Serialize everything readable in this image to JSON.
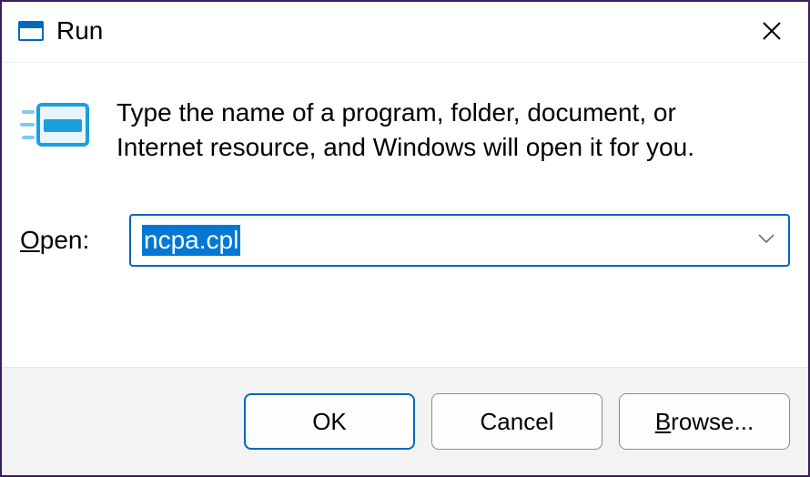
{
  "titlebar": {
    "title": "Run"
  },
  "description": "Type the name of a program, folder, document, or Internet resource, and Windows will open it for you.",
  "open": {
    "label_prefix": "O",
    "label_suffix": "pen:",
    "value": "ncpa.cpl"
  },
  "buttons": {
    "ok": "OK",
    "cancel": "Cancel",
    "browse_prefix": "B",
    "browse_suffix": "rowse..."
  }
}
